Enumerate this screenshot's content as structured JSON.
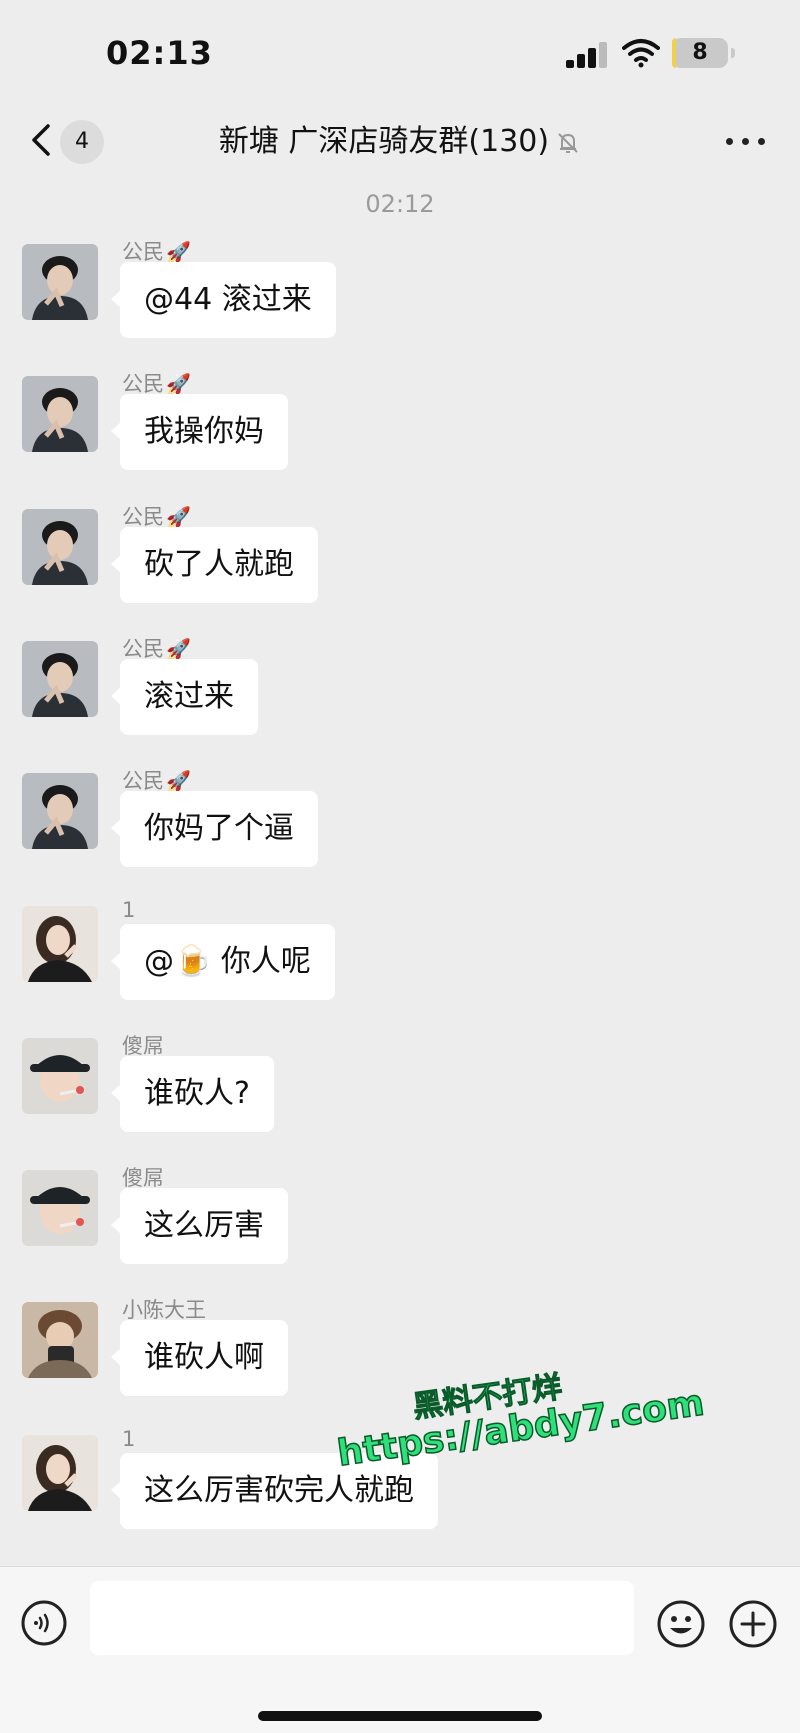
{
  "status_bar": {
    "time": "02:13",
    "battery": "8"
  },
  "nav": {
    "unread_count": "4",
    "title": "新塘 广深店骑友群(130)"
  },
  "timestamp": "02:12",
  "messages": [
    {
      "sender": "公民",
      "sender_emoji": "🚀",
      "text": "@44 滚过来",
      "avatar": "avatar-boy-dark"
    },
    {
      "sender": "公民",
      "sender_emoji": "🚀",
      "text": "我操你妈",
      "avatar": "avatar-boy-dark"
    },
    {
      "sender": "公民",
      "sender_emoji": "🚀",
      "text": "砍了人就跑",
      "avatar": "avatar-boy-dark"
    },
    {
      "sender": "公民",
      "sender_emoji": "🚀",
      "text": "滚过来",
      "avatar": "avatar-boy-dark"
    },
    {
      "sender": "公民",
      "sender_emoji": "🚀",
      "text": "你妈了个逼",
      "avatar": "avatar-boy-dark"
    },
    {
      "sender": "1",
      "sender_emoji": "",
      "text": "@🍺 你人呢",
      "avatar": "avatar-girl"
    },
    {
      "sender": "傻屌",
      "sender_emoji": "",
      "text": "谁砍人?",
      "avatar": "avatar-boy-cap"
    },
    {
      "sender": "傻屌",
      "sender_emoji": "",
      "text": "这么厉害",
      "avatar": "avatar-boy-cap"
    },
    {
      "sender": "小陈大王",
      "sender_emoji": "",
      "text": "谁砍人啊",
      "avatar": "avatar-boy-phone"
    },
    {
      "sender": "1",
      "sender_emoji": "",
      "text": "这么厉害砍完人就跑",
      "avatar": "avatar-girl"
    }
  ],
  "watermark": {
    "line1": "黑料不打烊",
    "line2": "https://abdy7.com"
  },
  "colors": {
    "background": "#ededed",
    "bubble": "#ffffff",
    "watermark": "#2fe07a"
  }
}
